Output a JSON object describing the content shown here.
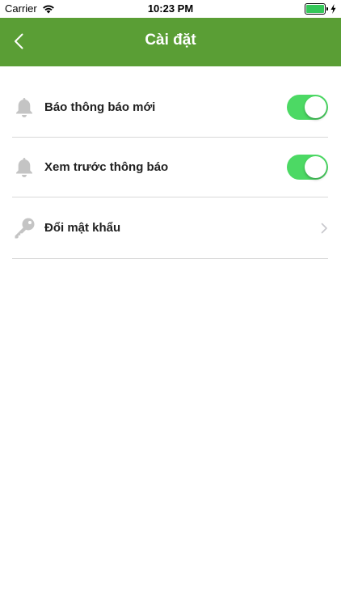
{
  "status_bar": {
    "carrier": "Carrier",
    "time": "10:23 PM"
  },
  "nav": {
    "title": "Cài đặt",
    "back_icon": "chevron-left-icon"
  },
  "settings": {
    "items": [
      {
        "label": "Báo thông báo mới",
        "icon": "bell-icon",
        "control": "toggle",
        "on": true
      },
      {
        "label": "Xem trước thông báo",
        "icon": "bell-icon",
        "control": "toggle",
        "on": true
      },
      {
        "label": "Đổi mật khẩu",
        "icon": "key-icon",
        "control": "chevron"
      }
    ]
  },
  "colors": {
    "nav_background": "#5a9e35",
    "toggle_on": "#4cd964",
    "icon_gray": "#c4c4c4",
    "divider": "#d8d8d8"
  }
}
